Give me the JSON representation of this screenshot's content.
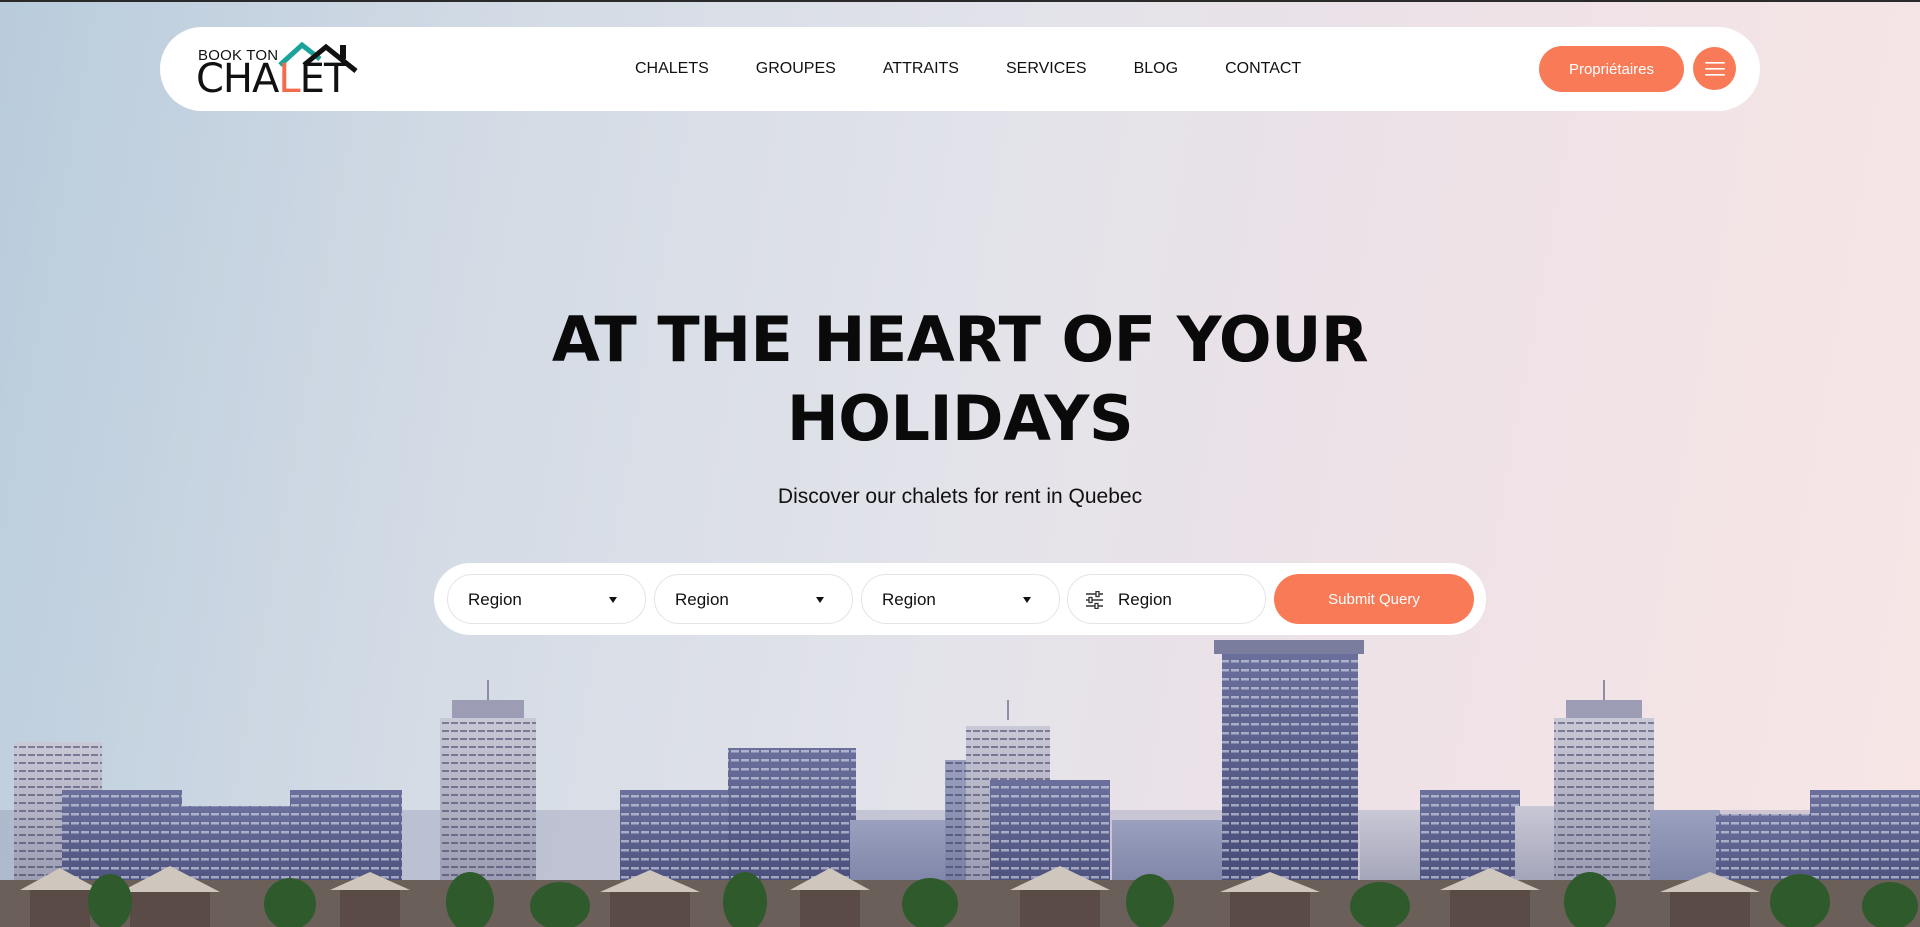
{
  "brand": {
    "line1": "BOOK TON",
    "line2_a": "CHA",
    "line2_b": "L",
    "line2_c": "ET",
    "accent_color": "#f26b4a",
    "roof_color": "#1aa39a"
  },
  "nav": {
    "items": [
      {
        "label": "CHALETS"
      },
      {
        "label": "GROUPES"
      },
      {
        "label": "ATTRAITS"
      },
      {
        "label": "SERVICES"
      },
      {
        "label": "BLOG"
      },
      {
        "label": "CONTACT"
      }
    ],
    "owners_label": "Propriétaires",
    "menu_icon": "hamburger-icon"
  },
  "hero": {
    "title_line1": "AT THE HEART OF YOUR",
    "title_line2": "HOLIDAYS",
    "subtitle": "Discover our chalets for rent in Quebec"
  },
  "search": {
    "selects": [
      {
        "value": "Region"
      },
      {
        "value": "Region"
      },
      {
        "value": "Region"
      }
    ],
    "filter_placeholder": "Region",
    "filter_icon": "sliders-icon",
    "submit_label": "Submit Query"
  },
  "colors": {
    "primary": "#f97a56",
    "text": "#111111",
    "navbar_bg": "#ffffff"
  }
}
